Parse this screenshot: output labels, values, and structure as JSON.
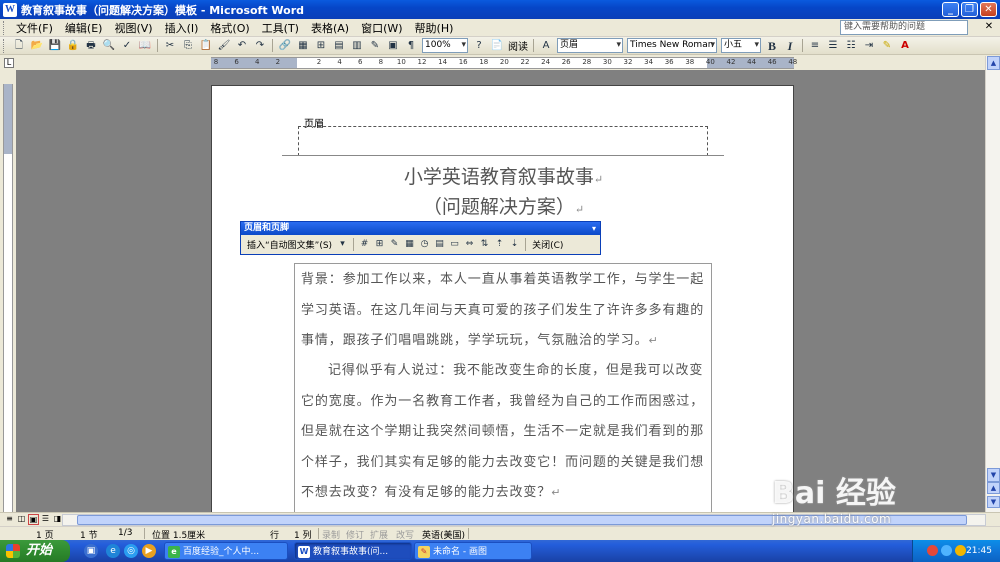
{
  "window": {
    "title": "教育叙事故事（问题解决方案）模板 - Microsoft Word"
  },
  "menubar": {
    "items": [
      "文件(F)",
      "编辑(E)",
      "视图(V)",
      "插入(I)",
      "格式(O)",
      "工具(T)",
      "表格(A)",
      "窗口(W)",
      "帮助(H)"
    ],
    "help_placeholder": "键入需要帮助的问题"
  },
  "toolbar": {
    "zoom": "100%",
    "read_label": "阅读",
    "style": "页眉",
    "font": "Times New Roman",
    "size": "小五",
    "bold": "B",
    "italic": "I"
  },
  "ruler": {
    "numbers": [
      "8",
      "6",
      "4",
      "2",
      "",
      "2",
      "4",
      "6",
      "8",
      "10",
      "12",
      "14",
      "16",
      "18",
      "20",
      "22",
      "24",
      "26",
      "28",
      "30",
      "32",
      "34",
      "36",
      "38",
      "40",
      "42",
      "44",
      "46",
      "48"
    ]
  },
  "document": {
    "header_label": "页眉",
    "title_line1": "小学英语教育叙事故事",
    "title_line2": "（问题解决方案）",
    "paragraph1": "背景：参加工作以来，本人一直从事着英语教学工作，与学生一起学习英语。在这几年间与天真可爱的孩子们发生了许许多多有趣的事情，跟孩子们唱唱跳跳，学学玩玩，气氛融洽的学习。",
    "paragraph2": "记得似乎有人说过：我不能改变生命的长度，但是我可以改变它的宽度。作为一名教育工作者，我曾经为自己的工作而困惑过，但是就在这个学期让我突然间顿悟，生活不一定就是我们看到的那个样子，我们其实有足够的能力去改变它！而问题的关键是我们想不想去改变？有没有足够的能力去改变？"
  },
  "hf_toolbar": {
    "title": "页眉和页脚",
    "insert_autotext": "插入“自动图文集”(S)",
    "close": "关闭(C)"
  },
  "statusbar": {
    "page": "1 页",
    "section": "1 节",
    "page_of": "1/3",
    "position": "位置 1.5厘米",
    "line": "行",
    "col": "1 列",
    "rec": "录制",
    "trk": "修订",
    "ext": "扩展",
    "ovr": "改写",
    "lang": "英语(美国)"
  },
  "taskbar": {
    "start": "开始",
    "tasks": [
      "百度经验_个人中...",
      "教育叙事故事(问...",
      "未命名 - 画图"
    ],
    "clock": "21:45"
  },
  "watermark": {
    "brand": "Bai 经验",
    "url": "jingyan.baidu.com"
  },
  "colors": {
    "titlebar": "#0a5ade",
    "taskbar": "#245edb",
    "start": "#2f8b2f"
  }
}
